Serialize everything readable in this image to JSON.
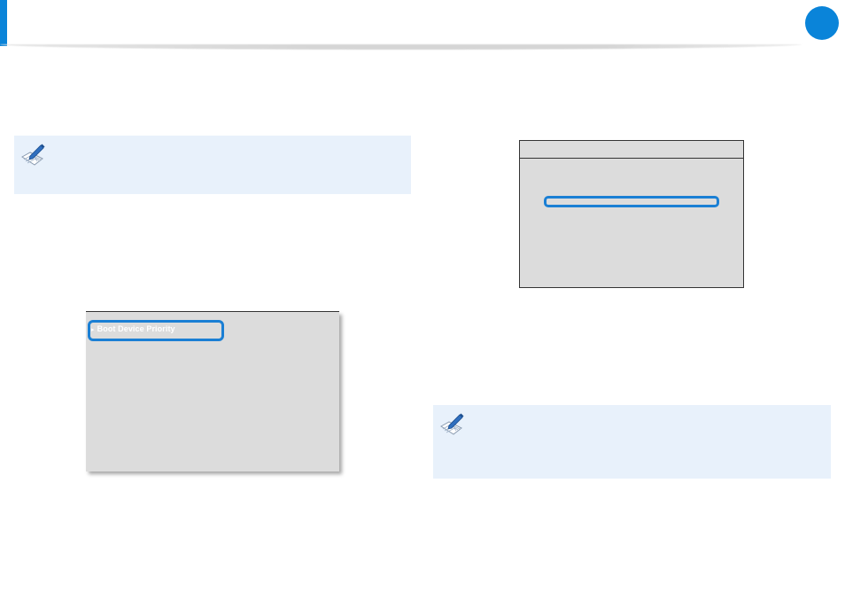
{
  "colors": {
    "accent": "#0a84d9",
    "note_background": "#e8f1fb",
    "highlight": "#1a7fd4",
    "panel_background": "#dcdcdc"
  },
  "icons": {
    "page_badge": "circle-badge",
    "note": "note-pencil-icon"
  },
  "bios_left": {
    "selected_item": "Boot Device Priority",
    "arrow": "▸"
  }
}
